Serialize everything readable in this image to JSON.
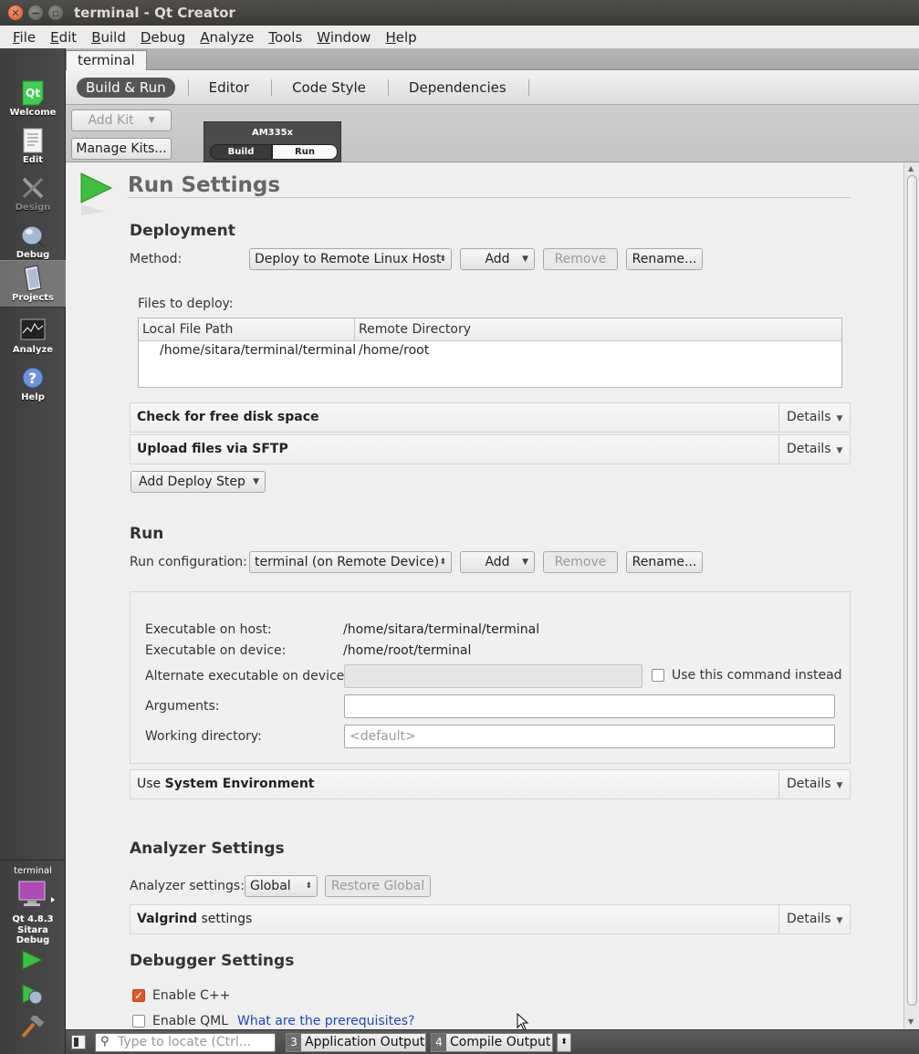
{
  "window": {
    "title": "terminal - Qt Creator"
  },
  "menu": [
    {
      "u": "F",
      "rest": "ile"
    },
    {
      "u": "E",
      "rest": "dit"
    },
    {
      "u": "B",
      "rest": "uild"
    },
    {
      "u": "D",
      "rest": "ebug"
    },
    {
      "u": "A",
      "rest": "nalyze"
    },
    {
      "u": "T",
      "rest": "ools"
    },
    {
      "u": "W",
      "rest": "indow"
    },
    {
      "u": "H",
      "rest": "elp"
    }
  ],
  "modes": [
    {
      "label": "Welcome",
      "icon": "qt-logo-icon"
    },
    {
      "label": "Edit",
      "icon": "document-icon"
    },
    {
      "label": "Design",
      "icon": "design-tools-icon"
    },
    {
      "label": "Debug",
      "icon": "bug-icon"
    },
    {
      "label": "Projects",
      "icon": "folder-icon"
    },
    {
      "label": "Analyze",
      "icon": "monitor-icon"
    },
    {
      "label": "Help",
      "icon": "help-icon"
    }
  ],
  "target": {
    "project": "terminal",
    "version": "Qt 4.8.3",
    "config": "Sitara Debug"
  },
  "project_tab": "terminal",
  "subtabs": [
    "Build & Run",
    "Editor",
    "Code Style",
    "Dependencies"
  ],
  "kits": {
    "add_kit": "Add Kit",
    "manage_kits": "Manage Kits...",
    "kit_name": "AM335x",
    "build_label": "Build",
    "run_label": "Run"
  },
  "run_settings": {
    "title": "Run Settings",
    "deployment": {
      "heading": "Deployment",
      "method_label": "Method:",
      "method_value": "Deploy to Remote Linux Host",
      "add": "Add",
      "remove": "Remove",
      "rename": "Rename...",
      "files_label": "Files to deploy:",
      "col_local": "Local File Path",
      "col_remote": "Remote Directory",
      "rows": [
        {
          "local": "/home/sitara/terminal/terminal",
          "remote": "/home/root"
        }
      ],
      "steps": [
        {
          "title": "Check for free disk space",
          "details": "Details"
        },
        {
          "title": "Upload files via SFTP",
          "details": "Details"
        }
      ],
      "add_step": "Add Deploy Step"
    },
    "run": {
      "heading": "Run",
      "config_label": "Run configuration:",
      "config_value": "terminal (on Remote Device)",
      "add": "Add",
      "remove": "Remove",
      "rename": "Rename...",
      "exec_host_label": "Executable on host:",
      "exec_host_value": "/home/sitara/terminal/terminal",
      "exec_device_label": "Executable on device:",
      "exec_device_value": "/home/root/terminal",
      "alt_exec_label": "Alternate executable on device:",
      "use_command_label": "Use this command instead",
      "arguments_label": "Arguments:",
      "working_dir_label": "Working directory:",
      "working_dir_placeholder": "<default>",
      "env_prefix": "Use ",
      "env_bold": "System Environment",
      "env_details": "Details"
    },
    "analyzer": {
      "heading": "Analyzer Settings",
      "label": "Analyzer settings:",
      "value": "Global",
      "restore": "Restore Global",
      "valgrind_bold": "Valgrind",
      "valgrind_rest": " settings",
      "details": "Details"
    },
    "debugger": {
      "heading": "Debugger Settings",
      "enable_cpp": "Enable C++",
      "enable_qml": "Enable QML",
      "prereq_link": "What are the prerequisites?"
    }
  },
  "bottom": {
    "locate_placeholder": "Type to locate (Ctrl...",
    "app_output_num": "3",
    "app_output": "Application Output",
    "compile_output_num": "4",
    "compile_output": "Compile Output"
  }
}
